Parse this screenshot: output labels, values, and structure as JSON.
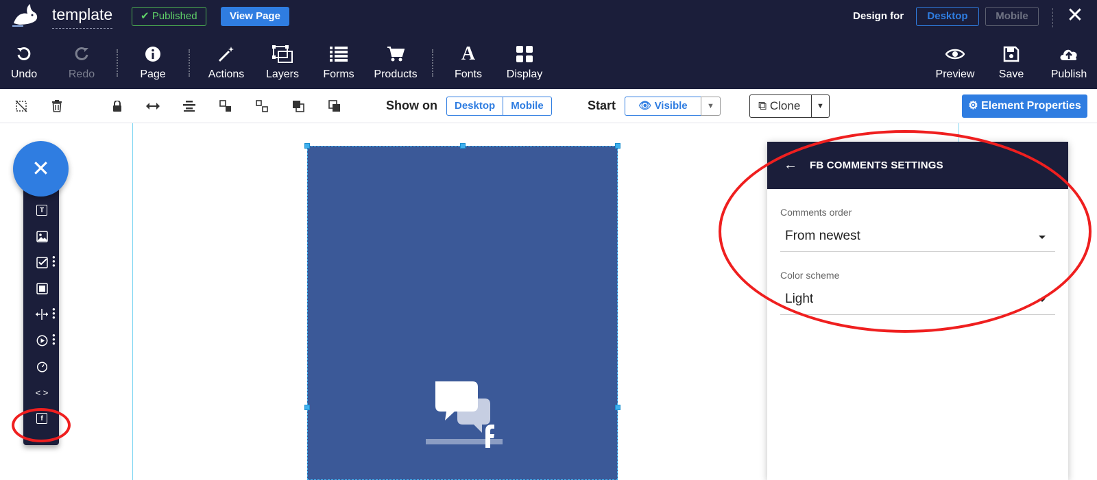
{
  "header": {
    "project_title": "template",
    "published_badge": "✔ Published",
    "view_page": "View Page",
    "design_for_label": "Design for",
    "design_for_desktop": "Desktop",
    "design_for_mobile": "Mobile"
  },
  "toolbar": {
    "undo": "Undo",
    "redo": "Redo",
    "page": "Page",
    "actions": "Actions",
    "layers": "Layers",
    "forms": "Forms",
    "products": "Products",
    "fonts": "Fonts",
    "display": "Display",
    "preview": "Preview",
    "save": "Save",
    "publish": "Publish"
  },
  "subtoolbar": {
    "show_on_label": "Show on",
    "show_on_desktop": "Desktop",
    "show_on_mobile": "Mobile",
    "start_label": "Start",
    "visible_label": "Visible",
    "clone_label": "Clone",
    "element_properties": "⚙ Element Properties"
  },
  "panel": {
    "title": "FB COMMENTS SETTINGS",
    "fields": [
      {
        "label": "Comments order",
        "value": "From newest"
      },
      {
        "label": "Color scheme",
        "value": "Light"
      }
    ]
  },
  "colors": {
    "dark_navy": "#1b1e3a",
    "accent_blue": "#2f7de1",
    "facebook_blue": "#3b5998",
    "published_green": "#4caf50",
    "annotation_red": "#ef1f1f"
  }
}
